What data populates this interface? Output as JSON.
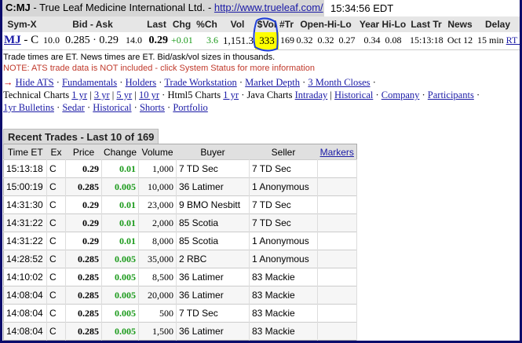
{
  "title": {
    "symbol": "C:MJ",
    "company": " - True Leaf Medicine International Ltd. - ",
    "url": "http://www.trueleaf.com/",
    "time": "15:34:56 EDT"
  },
  "quote": {
    "headers": [
      "Sym-X",
      "Bid - Ask",
      "Last",
      "Chg",
      "%Ch",
      "Vol",
      "$Vol",
      "#Tr",
      "Open-Hi-Lo",
      "Year Hi-Lo",
      "Last Tr",
      "News",
      "Delay"
    ],
    "sym": "MJ",
    "exch": " - C",
    "bid_size": "10.0",
    "bid": "0.285",
    "ask": "0.29",
    "ask_size": "14.0",
    "last": "0.29",
    "chg": "+0.01",
    "pct": "3.6",
    "vol": "1,151.3",
    "dvol": "333",
    "trades": "169",
    "open": "0.32",
    "high": "0.32",
    "low": "0.27",
    "year_hi": "0.34",
    "year_lo": "0.08",
    "last_tr": "15:13:18",
    "news": "Oct 12",
    "delay": "15 min",
    "rt": "RT 2"
  },
  "notes": {
    "line1": "Trade times are ET. News times are ET. Bid/ask/vol sizes in thousands.",
    "line2": "NOTE: ATS trade data is NOT included - click System Status for more information"
  },
  "links": {
    "row1": [
      "Hide ATS",
      "Fundamentals",
      "Holders",
      "Trade Workstation",
      "Market Depth",
      "3 Month Closes"
    ],
    "tech_label": "Technical Charts",
    "tech": [
      "1 yr",
      "3 yr",
      "5 yr",
      "10 yr"
    ],
    "html5_label": "Html5 Charts",
    "html5": [
      "1 yr"
    ],
    "java_label": "Java Charts",
    "java": [
      "Intraday",
      "Historical"
    ],
    "row2_more": [
      "Company",
      "Participants"
    ],
    "row3": [
      "1yr Bulletins",
      "Sedar",
      "Historical",
      "Shorts",
      "Portfolio"
    ]
  },
  "recent": {
    "tab": "Recent Trades - Last 10 of 169",
    "headers": [
      "Time ET",
      "Ex",
      "Price",
      "Change",
      "Volume",
      "Buyer",
      "Seller",
      "Markers"
    ],
    "rows": [
      [
        "15:13:18",
        "C",
        "0.29",
        "0.01",
        "1,000",
        "7 TD Sec",
        "7 TD Sec"
      ],
      [
        "15:00:19",
        "C",
        "0.285",
        "0.005",
        "10,000",
        "36 Latimer",
        "1 Anonymous"
      ],
      [
        "14:31:30",
        "C",
        "0.29",
        "0.01",
        "23,000",
        "9 BMO Nesbitt",
        "7 TD Sec"
      ],
      [
        "14:31:22",
        "C",
        "0.29",
        "0.01",
        "2,000",
        "85 Scotia",
        "7 TD Sec"
      ],
      [
        "14:31:22",
        "C",
        "0.29",
        "0.01",
        "8,000",
        "85 Scotia",
        "1 Anonymous"
      ],
      [
        "14:28:52",
        "C",
        "0.285",
        "0.005",
        "35,000",
        "2 RBC",
        "1 Anonymous"
      ],
      [
        "14:10:02",
        "C",
        "0.285",
        "0.005",
        "8,500",
        "36 Latimer",
        "83 Mackie"
      ],
      [
        "14:08:04",
        "C",
        "0.285",
        "0.005",
        "20,000",
        "36 Latimer",
        "83 Mackie"
      ],
      [
        "14:08:04",
        "C",
        "0.285",
        "0.005",
        "500",
        "7 TD Sec",
        "83 Mackie"
      ],
      [
        "14:08:04",
        "C",
        "0.285",
        "0.005",
        "1,500",
        "36 Latimer",
        "83 Mackie"
      ]
    ]
  },
  "colors": {
    "frame": "#0b0b6b",
    "highlight": "#ffff00",
    "annotation": "#1f3fd6",
    "up": "#1a9a1a",
    "note": "#c0392b"
  }
}
